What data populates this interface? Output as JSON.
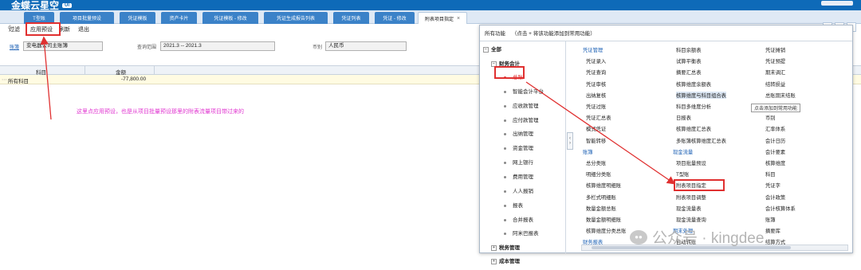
{
  "app": {
    "title": "金蝶云星空",
    "badge": "UI"
  },
  "tabs": [
    {
      "label": "T型账"
    },
    {
      "label": "项目批量预设"
    },
    {
      "label": "凭证模板"
    },
    {
      "label": "资产卡片"
    },
    {
      "label": "凭证模板 - 修改"
    },
    {
      "label": "凭证生成报告列表"
    },
    {
      "label": "凭证列表"
    },
    {
      "label": "凭证 - 修改"
    },
    {
      "label": "附表项目指定"
    }
  ],
  "toolbar": {
    "filter": "过滤",
    "apply_preset": "应用预设",
    "refresh": "刷新",
    "exit": "退出"
  },
  "form": {
    "book_label": "账簿",
    "book_value": "变电器公司主账簿",
    "range_label": "查询范围",
    "range_value": "2021.3 -- 2021.3",
    "currency_label": "币别",
    "currency_value": "人民币"
  },
  "grid": {
    "headers": [
      "科目",
      "金额"
    ],
    "rows": [
      {
        "subject": "所有科目",
        "amount": "-77,800.00"
      }
    ]
  },
  "annotation": "这里点应用预设，也是从项目批量预设那里的附表流量项目带过来的",
  "panel": {
    "title": "所有功能",
    "hint": "（点击 + 将该功能添加到常用功能）",
    "tree": [
      {
        "label": "全部",
        "kind": "root"
      },
      {
        "label": "财务会计",
        "kind": "group"
      },
      {
        "label": "总账",
        "kind": "selected"
      },
      {
        "label": "智能会计平台",
        "kind": "leaf"
      },
      {
        "label": "应收款管理",
        "kind": "leaf"
      },
      {
        "label": "应付款管理",
        "kind": "leaf"
      },
      {
        "label": "出纳管理",
        "kind": "leaf"
      },
      {
        "label": "资金管理",
        "kind": "leaf"
      },
      {
        "label": "网上银行",
        "kind": "leaf"
      },
      {
        "label": "费用管理",
        "kind": "leaf"
      },
      {
        "label": "人人报销",
        "kind": "leaf"
      },
      {
        "label": "报表",
        "kind": "leaf"
      },
      {
        "label": "合并报表",
        "kind": "leaf"
      },
      {
        "label": "阿米巴报表",
        "kind": "leaf"
      },
      {
        "label": "税务管理",
        "kind": "group"
      },
      {
        "label": "成本管理",
        "kind": "group"
      }
    ],
    "col1": [
      {
        "label": "凭证管理",
        "kind": "group"
      },
      {
        "label": "凭证录入"
      },
      {
        "label": "凭证查询"
      },
      {
        "label": "凭证审核"
      },
      {
        "label": "出纳复核"
      },
      {
        "label": "凭证过账"
      },
      {
        "label": "凭证汇总表"
      },
      {
        "label": "模式凭证"
      },
      {
        "label": "智能转移"
      },
      {
        "label": "账簿",
        "kind": "group"
      },
      {
        "label": "总分类账"
      },
      {
        "label": "明细分类账"
      },
      {
        "label": "核算维度明细账"
      },
      {
        "label": "多栏式明细账"
      },
      {
        "label": "数量金额总账"
      },
      {
        "label": "数量金额明细账"
      },
      {
        "label": "核算维度分类总账"
      },
      {
        "label": "财务报表",
        "kind": "group"
      }
    ],
    "col2": [
      {
        "label": "科目余额表"
      },
      {
        "label": "试算平衡表"
      },
      {
        "label": "摘要汇总表"
      },
      {
        "label": "核算维度余额表"
      },
      {
        "label": "核算维度与科目组合表",
        "kind": "hover"
      },
      {
        "label": "科目多维度分析"
      },
      {
        "label": "日报表"
      },
      {
        "label": "核算维度汇总表"
      },
      {
        "label": "多账簿核算维度汇总表"
      },
      {
        "label": "现金流量",
        "kind": "group"
      },
      {
        "label": "项目批量预设"
      },
      {
        "label": "T型账"
      },
      {
        "label": "附表项目指定",
        "kind": "boxed"
      },
      {
        "label": "附表项目调整"
      },
      {
        "label": "现金流量表"
      },
      {
        "label": "现金流量查询"
      },
      {
        "label": "期末处理",
        "kind": "group"
      },
      {
        "label": "自动转账"
      }
    ],
    "col3": [
      {
        "label": "凭证摊销"
      },
      {
        "label": "凭证预提"
      },
      {
        "label": "期末调汇"
      },
      {
        "label": "结转损益"
      },
      {
        "label": "总账期末结账"
      },
      {
        "label": "自动对账"
      },
      {
        "label": "币别"
      },
      {
        "label": "汇率体系"
      },
      {
        "label": "会计日历"
      },
      {
        "label": "会计要素"
      },
      {
        "label": "核算维度"
      },
      {
        "label": "科目"
      },
      {
        "label": "凭证字"
      },
      {
        "label": "会计政策"
      },
      {
        "label": "会计核算体系"
      },
      {
        "label": "账簿"
      },
      {
        "label": "摘要库"
      },
      {
        "label": "结算方式"
      }
    ],
    "tooltip": "点击添加到常用功能"
  },
  "watermark": "公众号 · kingdee",
  "colors": {
    "brand": "#0e6ab8",
    "highlight": "#e03030",
    "annotation": "#e036d0"
  }
}
